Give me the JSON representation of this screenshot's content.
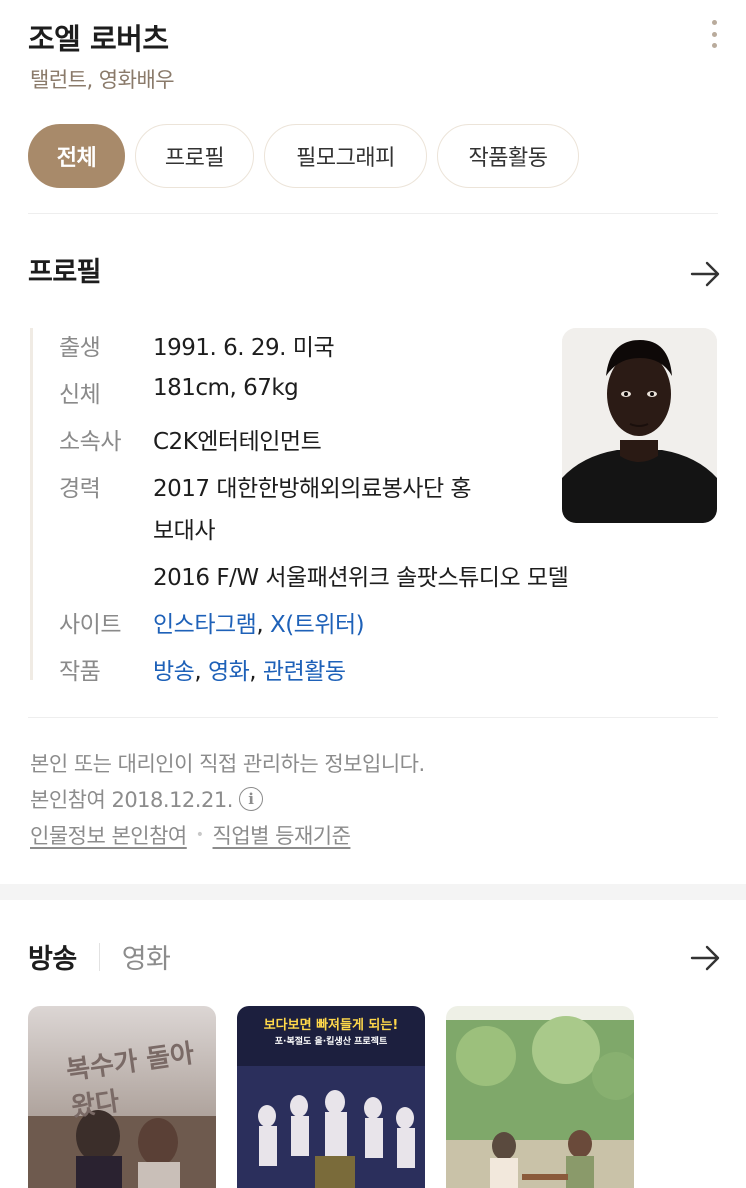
{
  "header": {
    "name": "조엘 로버츠",
    "subtitle": "탤런트, 영화배우",
    "more_icon": "more-vertical-icon"
  },
  "tabs": [
    {
      "label": "전체",
      "active": true
    },
    {
      "label": "프로필",
      "active": false
    },
    {
      "label": "필모그래피",
      "active": false
    },
    {
      "label": "작품활동",
      "active": false
    }
  ],
  "profile": {
    "title": "프로필",
    "arrow_icon": "arrow-right-icon",
    "rows": {
      "birth": {
        "label": "출생",
        "value": "1991. 6. 29. 미국"
      },
      "body": {
        "label": "신체",
        "value": "181cm, 67kg"
      },
      "agency": {
        "label": "소속사",
        "value": "C2K엔터테인먼트"
      },
      "career": {
        "label": "경력",
        "line1": "2017 대한한방해외의료봉사단 홍",
        "line2": "보대사",
        "line3": "2016 F/W 서울패션위크 솔팟스튜디오 모델"
      },
      "site": {
        "label": "사이트",
        "link1": "인스타그램",
        "sep": ",",
        "link2": "X(트위터)"
      },
      "works": {
        "label": "작품",
        "link1": "방송",
        "link2": "영화",
        "link3": "관련활동",
        "sep": ","
      }
    },
    "photo_alt": "profile-photo"
  },
  "notice": {
    "line1": "본인 또는 대리인이 직접 관리하는 정보입니다.",
    "line2": "본인참여 2018.12.21.",
    "info_glyph": "i",
    "link1": "인물정보 본인참여",
    "dot": "•",
    "link2": "직업별 등재기준"
  },
  "media": {
    "tab_broadcast": "방송",
    "tab_movie": "영화",
    "arrow_icon": "arrow-right-icon",
    "posters": [
      {
        "title_text": "복수가 돌아왔다"
      },
      {
        "title_text": "보다보면 빠져들게 되는!",
        "subtitle_text": "포·복절도 올·킬생산 프로젝트"
      },
      {
        "title_text": ""
      }
    ]
  },
  "colors": {
    "accent": "#a88a6a",
    "link": "#1e61b8",
    "muted": "#8c8c8c"
  }
}
